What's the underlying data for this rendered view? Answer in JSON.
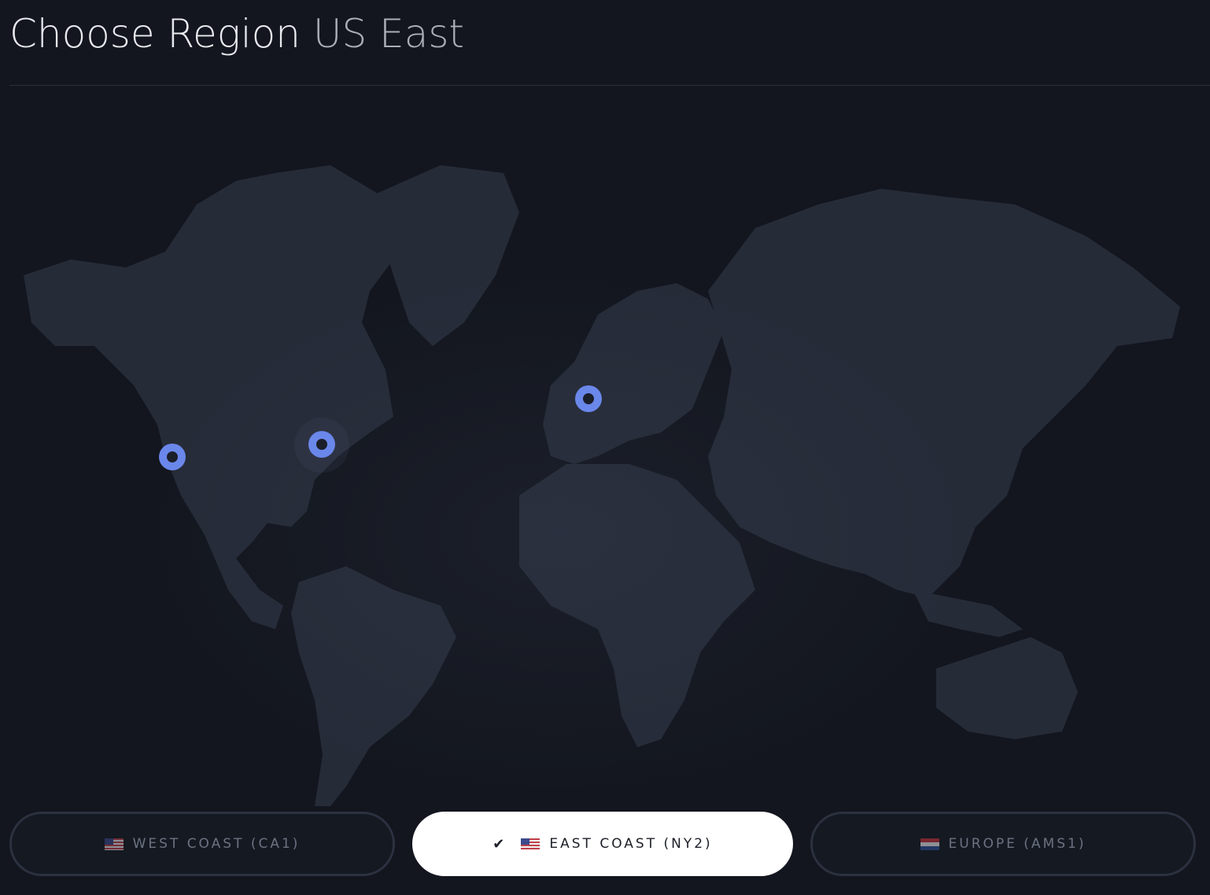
{
  "header": {
    "title": "Choose Region",
    "current_region": "US East"
  },
  "map": {
    "markers": [
      {
        "name": "west-coast-marker",
        "region": "CA1"
      },
      {
        "name": "east-coast-marker",
        "region": "NY2"
      },
      {
        "name": "europe-marker",
        "region": "AMS1"
      }
    ]
  },
  "regions": [
    {
      "label": "WEST COAST (CA1)",
      "flag": "us-flag-icon",
      "selected": false
    },
    {
      "label": "EAST COAST (NY2)",
      "flag": "us-flag-icon",
      "selected": true
    },
    {
      "label": "EUROPE (AMS1)",
      "flag": "netherlands-flag-icon",
      "selected": false
    }
  ],
  "colors": {
    "background": "#13161e",
    "continent": "#262b38",
    "marker": "#6a87ea",
    "selected_button": "#ffffff"
  }
}
